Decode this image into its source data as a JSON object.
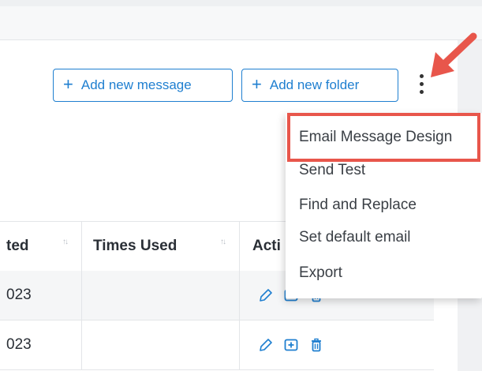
{
  "toolbar": {
    "add_message_label": "Add new message",
    "add_folder_label": "Add new folder",
    "plus_glyph": "+"
  },
  "menu": {
    "items": [
      {
        "label": "Email Message Design"
      },
      {
        "label": "Send Test"
      },
      {
        "label": "Find and Replace"
      },
      {
        "label": "Set default email"
      },
      {
        "label": "Export"
      }
    ]
  },
  "table": {
    "headers": [
      "ted",
      "Times Used",
      "Acti"
    ],
    "rows": [
      {
        "date": "023",
        "times_used": ""
      },
      {
        "date": "023",
        "times_used": ""
      }
    ]
  },
  "colors": {
    "accent": "#1f7fd0",
    "highlight": "#e8564b"
  },
  "icons": {
    "kebab": "kebab-menu-icon",
    "arrow": "pointer-arrow-icon",
    "edit": "pencil-icon",
    "add": "add-square-icon",
    "delete": "trash-icon",
    "sort": "sort-icon"
  }
}
